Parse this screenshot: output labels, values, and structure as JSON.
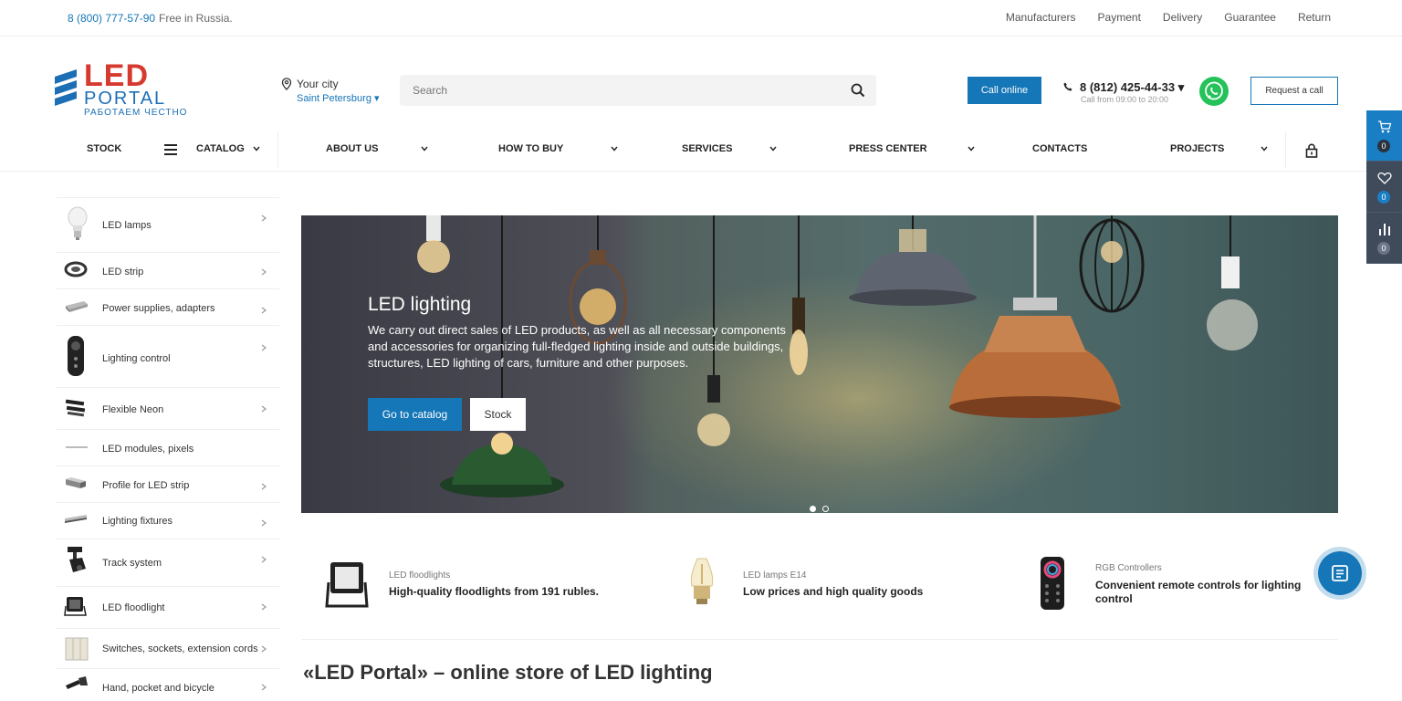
{
  "topbar": {
    "phone": "8 (800) 777-57-90",
    "free_note": "Free in Russia.",
    "links": [
      "Manufacturers",
      "Payment",
      "Delivery",
      "Guarantee",
      "Return"
    ]
  },
  "logo": {
    "led": "LED",
    "portal": "PORTAL",
    "slogan": "РАБОТАЕМ ЧЕСТНО"
  },
  "city": {
    "label": "Your city",
    "value": "Saint Petersburg"
  },
  "search": {
    "placeholder": "Search",
    "value": ""
  },
  "header": {
    "call_online": "Call online",
    "phone": "8 (812) 425-44-33",
    "hours": "Call from 09:00 to 20:00",
    "request_call": "Request a call"
  },
  "nav": {
    "items": [
      "STOCK",
      "CATALOG",
      "ABOUT US",
      "HOW TO BUY",
      "SERVICES",
      "PRESS CENTER",
      "CONTACTS",
      "PROJECTS"
    ]
  },
  "side_panel": {
    "cart_count": "0",
    "favorites_count": "0",
    "compare_count": "0"
  },
  "catalog": {
    "items": [
      "LED lamps",
      "LED strip",
      "Power supplies, adapters",
      "Lighting control",
      "Flexible Neon",
      "LED modules, pixels",
      "Profile for LED strip",
      "Lighting fixtures",
      "Track system",
      "LED floodlight",
      "Switches, sockets, extension cords",
      "Hand, pocket and bicycle"
    ]
  },
  "hero": {
    "title": "LED lighting",
    "text": "We carry out direct sales of LED products, as well as all necessary components and accessories for organizing full-fledged lighting inside and outside buildings, structures, LED lighting of cars, furniture and other purposes.",
    "primary_button": "Go to catalog",
    "secondary_button": "Stock",
    "slides": 2,
    "active_slide": 1
  },
  "promos": [
    {
      "category": "LED floodlights",
      "title": "High-quality floodlights from 191 rubles."
    },
    {
      "category": "LED lamps E14",
      "title": "Low prices and high quality goods"
    },
    {
      "category": "RGB Controllers",
      "title_line1": "Convenient remote controls for lighting",
      "title_line2": "control"
    }
  ],
  "page_title": "«LED Portal» – online store of LED lighting",
  "colors": {
    "accent": "#1576b8",
    "logo_red": "#d63a2e",
    "whatsapp": "#25c25a",
    "panel": "#3f4a5a"
  }
}
